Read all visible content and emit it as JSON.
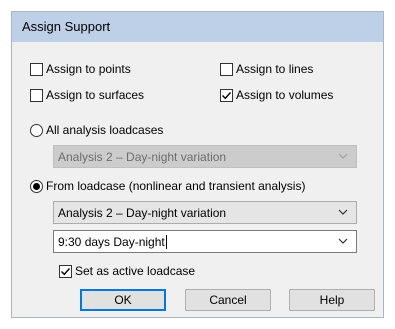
{
  "dialog": {
    "title": "Assign Support",
    "checkboxes": {
      "points": {
        "label": "Assign to points",
        "checked": false
      },
      "lines": {
        "label": "Assign to lines",
        "checked": false
      },
      "surfaces": {
        "label": "Assign to surfaces",
        "checked": false
      },
      "volumes": {
        "label": "Assign to volumes",
        "checked": true
      }
    },
    "radio_all": {
      "label": "All analysis loadcases",
      "selected": false
    },
    "all_loadcases_select": {
      "value": "Analysis 2 – Day-night variation",
      "enabled": false
    },
    "radio_from": {
      "label": "From loadcase (nonlinear and transient analysis)",
      "selected": true
    },
    "analysis_select": {
      "value": "Analysis 2 – Day-night variation",
      "enabled": true
    },
    "loadcase_input": {
      "value": "9:30 days Day-night"
    },
    "set_active": {
      "label": "Set as active loadcase",
      "checked": true
    },
    "buttons": {
      "ok": "OK",
      "cancel": "Cancel",
      "help": "Help"
    }
  },
  "icons": {
    "check": "check-mark-icon",
    "dropdown": "chevron-down-icon"
  },
  "colors": {
    "titlebar": "#bed0e8",
    "dialog_background": "#f0f0f0",
    "default_button_border": "#0078d7"
  }
}
